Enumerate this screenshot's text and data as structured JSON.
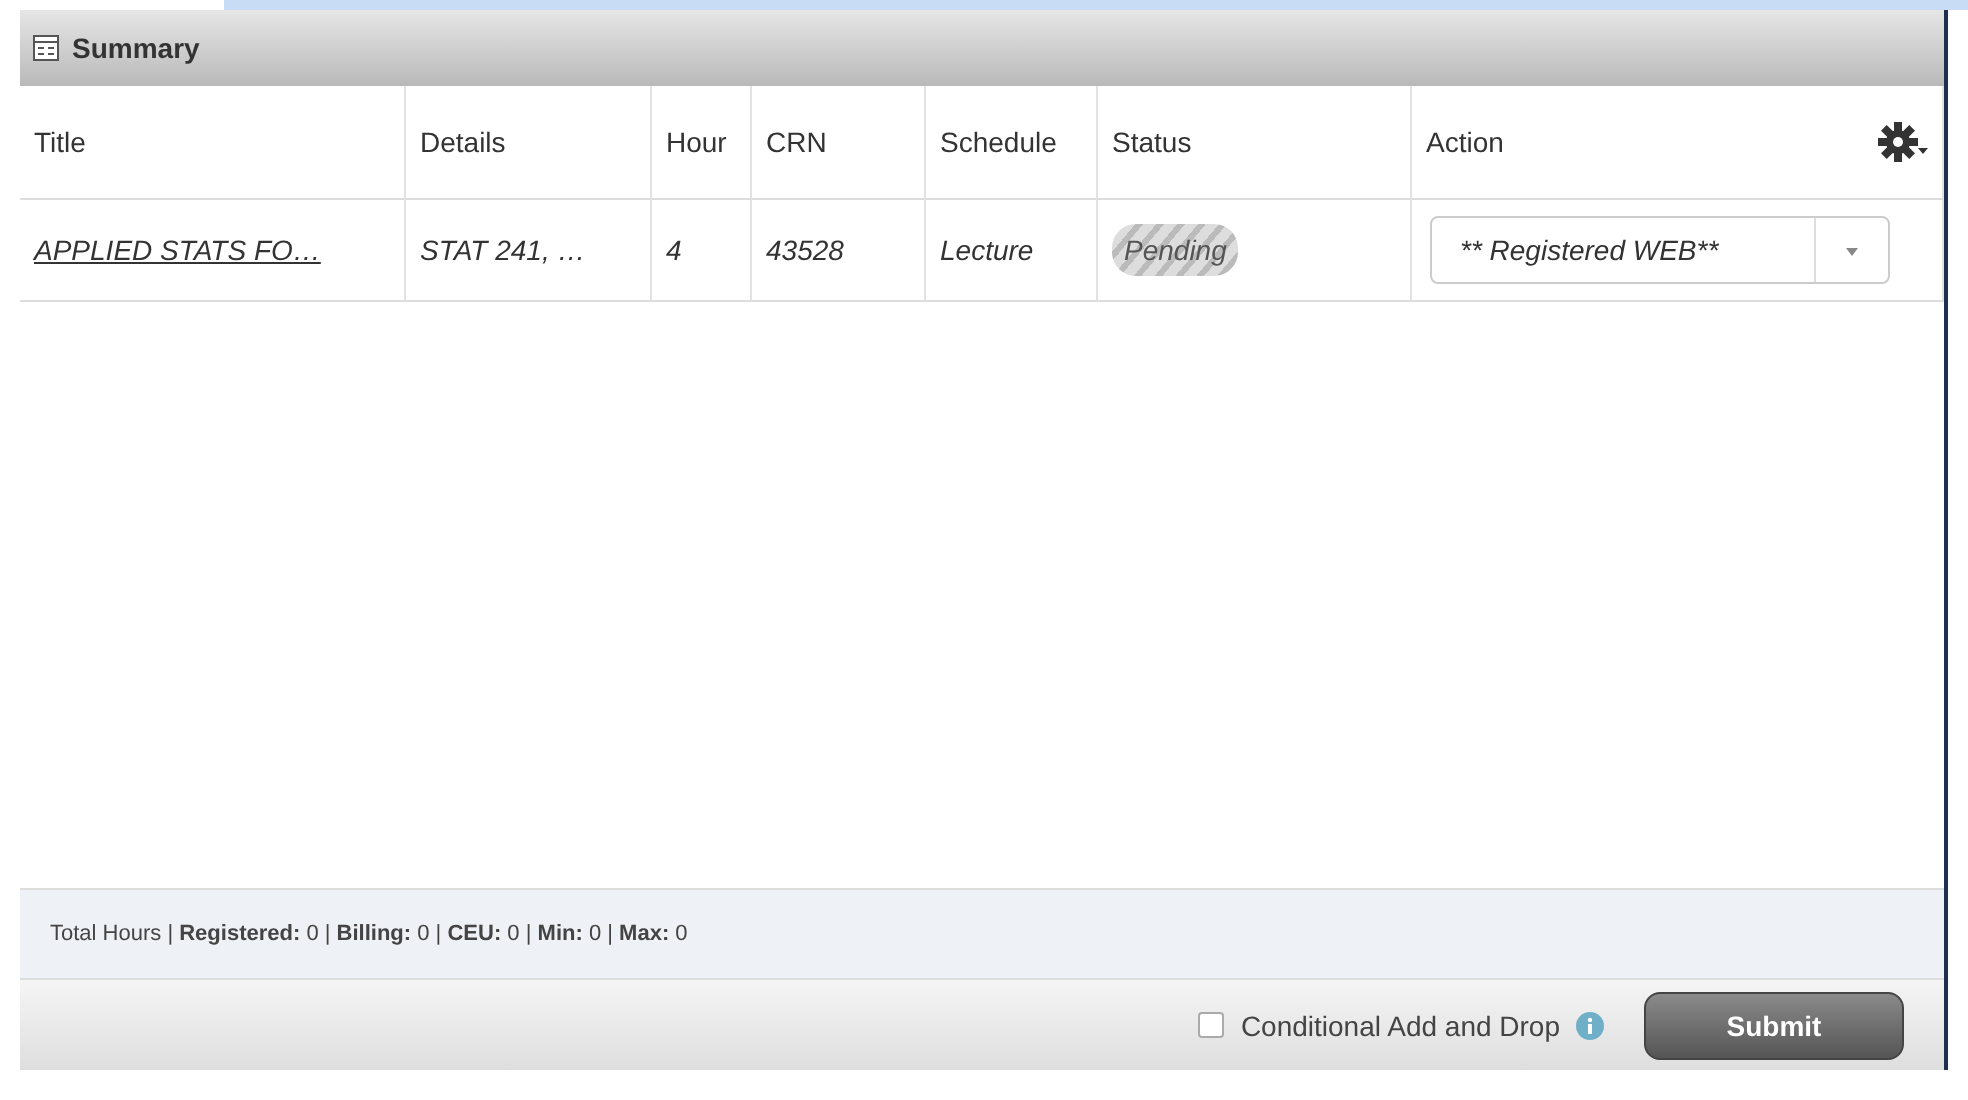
{
  "panel": {
    "title": "Summary"
  },
  "table": {
    "columns": [
      "Title",
      "Details",
      "Hour",
      "CRN",
      "Schedule",
      "Status",
      "Action"
    ],
    "rows": [
      {
        "title": "APPLIED STATS FO…",
        "details": "STAT 241, …",
        "hours": "4",
        "crn": "43528",
        "schedule": "Lecture",
        "status": "Pending",
        "action": "** Registered WEB**"
      }
    ]
  },
  "totals": "Total Hours | **Registered:** 0 | **Billing:** 0 | **CEU:** 0 | **Min:** 0 | **Max:** 0",
  "footer": {
    "conditional": {
      "label": "Conditional Add and Drop",
      "checked": false
    },
    "submit": "Submit"
  }
}
